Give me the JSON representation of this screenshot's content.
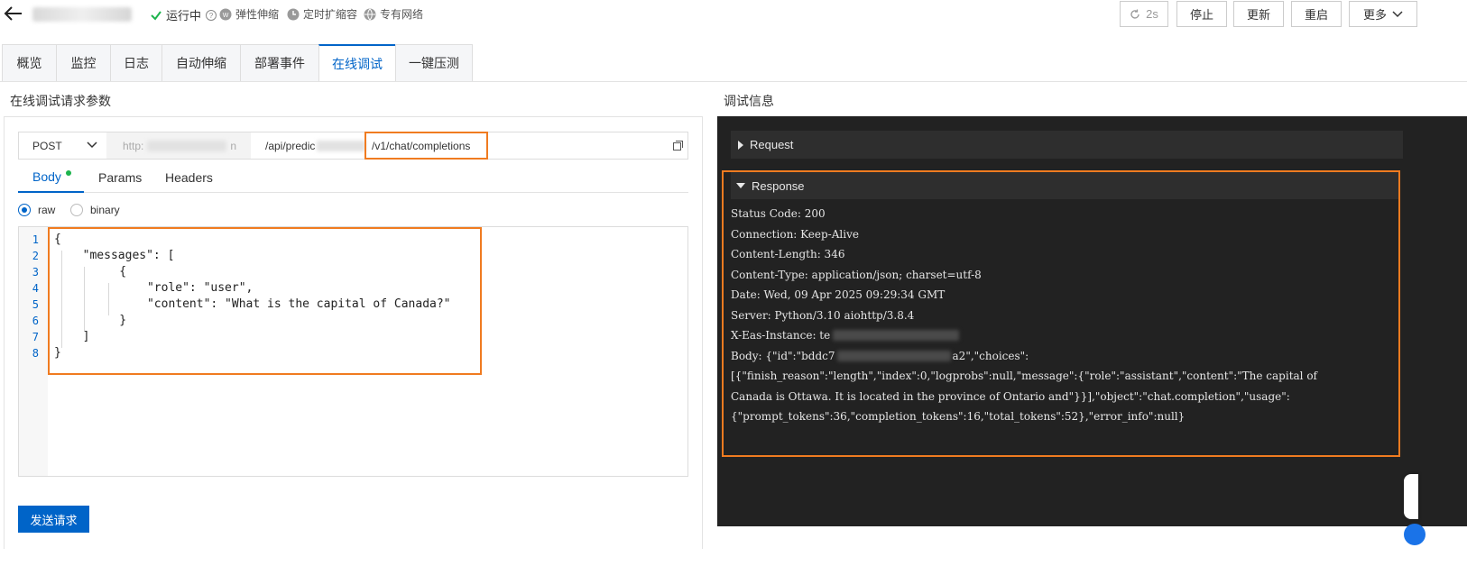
{
  "header": {
    "status_running": "运行中",
    "elastic_scaling": "弹性伸缩",
    "scheduled_scaling": "定时扩缩容",
    "private_network": "专有网络",
    "refresh_interval": "2s",
    "buttons": {
      "stop": "停止",
      "update": "更新",
      "restart": "重启",
      "more": "更多"
    }
  },
  "tabs": [
    "概览",
    "监控",
    "日志",
    "自动伸缩",
    "部署事件",
    "在线调试",
    "一键压测"
  ],
  "active_tab": "在线调试",
  "left": {
    "section_title": "在线调试请求参数",
    "method": "POST",
    "host_prefix": "http:",
    "host_suffix": "n",
    "path_prefix": "/api/predic",
    "path_suffix": "/v1/chat/completions",
    "subtabs": {
      "body": "Body",
      "params": "Params",
      "headers": "Headers"
    },
    "radio": {
      "raw": "raw",
      "binary": "binary"
    },
    "code_lines": [
      "{",
      "  \"messages\": [",
      "    {",
      "      \"role\": \"user\",",
      "      \"content\": \"What is the capital of Canada?\"",
      "    }",
      "  ]",
      "}"
    ],
    "line_numbers": [
      "1",
      "2",
      "3",
      "4",
      "5",
      "6",
      "7",
      "8"
    ],
    "send_button": "发送请求"
  },
  "right": {
    "section_title": "调试信息",
    "request_label": "Request",
    "response_label": "Response",
    "status_code": "Status Code: 200",
    "connection": "Connection: Keep-Alive",
    "content_length": "Content-Length: 346",
    "content_type": "Content-Type: application/json; charset=utf-8",
    "date": "Date: Wed, 09 Apr 2025 09:29:34 GMT",
    "server": "Server: Python/3.10 aiohttp/3.8.4",
    "instance_prefix": "X-Eas-Instance: te",
    "body_prefix": "Body: {\"id\":\"bddc7",
    "body_mid": "a2\",\"choices\":",
    "body_line2": "[{\"finish_reason\":\"length\",\"index\":0,\"logprobs\":null,\"message\":{\"role\":\"assistant\",\"content\":\"The capital of",
    "body_line3": "Canada is Ottawa. It is located in the province of Ontario and\"}}],\"object\":\"chat.completion\",\"usage\":",
    "body_line4": "{\"prompt_tokens\":36,\"completion_tokens\":16,\"total_tokens\":52},\"error_info\":null}"
  }
}
